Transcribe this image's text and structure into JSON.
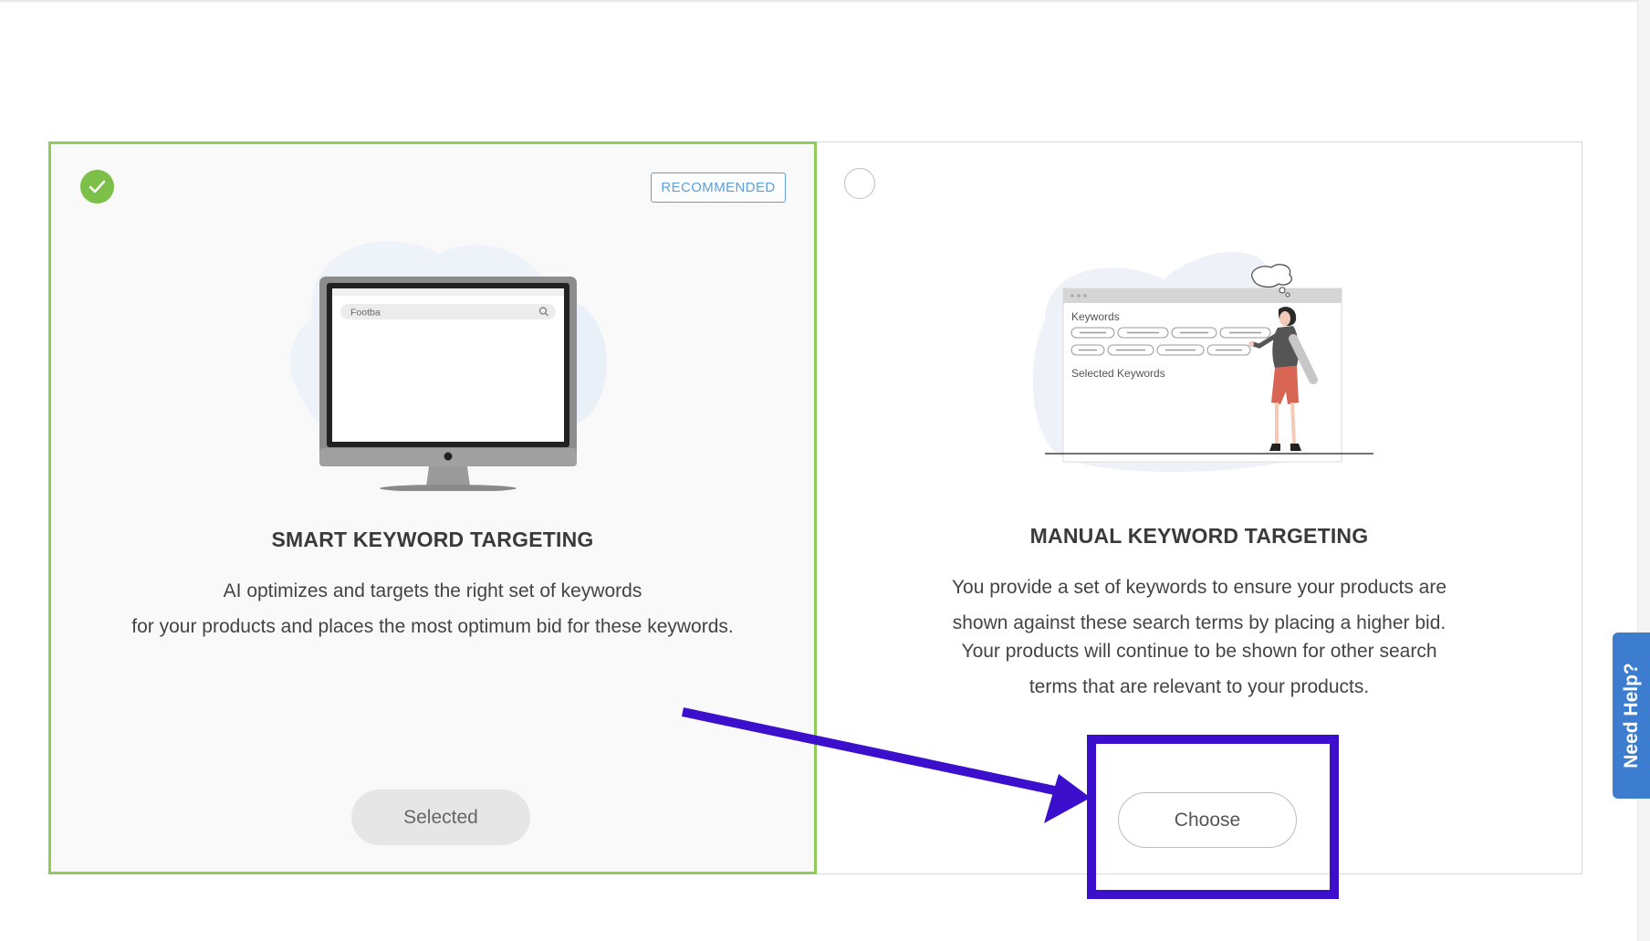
{
  "options": {
    "smart": {
      "badge": "RECOMMENDED",
      "title": "SMART KEYWORD TARGETING",
      "description_lines": [
        "AI optimizes and targets the right set of keywords",
        "for your products and places the most optimum bid for these keywords."
      ],
      "button_label": "Selected",
      "selected": true,
      "illustration": {
        "search_text": "Footba"
      }
    },
    "manual": {
      "title": "MANUAL KEYWORD TARGETING",
      "description_lines": [
        "You provide a set of keywords to ensure your products are",
        "shown against these search terms by placing a higher bid.",
        "Your products will continue to be shown for other search",
        "terms that are relevant to your products."
      ],
      "button_label": "Choose",
      "selected": false,
      "illustration": {
        "keywords_label": "Keywords",
        "selected_keywords_label": "Selected Keywords"
      }
    }
  },
  "help_tab": {
    "label": "Need Help?"
  },
  "icons": {
    "selected_check": "check-icon",
    "unselected_radio": "radio-empty-icon",
    "annotation_arrow": "arrow-icon"
  },
  "colors": {
    "selected_border": "#8fcc5a",
    "check_fill": "#7cc04a",
    "badge": "#5f9fd9",
    "help_tab": "#3d7dd0",
    "annotation": "#3b0fcc"
  }
}
